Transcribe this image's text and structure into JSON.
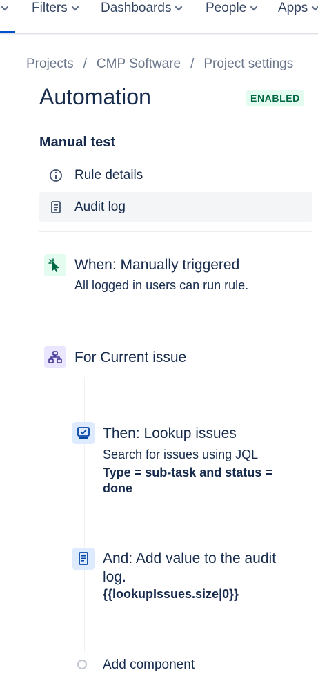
{
  "nav": {
    "items": [
      {
        "label": "Filters"
      },
      {
        "label": "Dashboards"
      },
      {
        "label": "People"
      },
      {
        "label": "Apps"
      }
    ]
  },
  "breadcrumb": {
    "items": [
      "Projects",
      "CMP Software",
      "Project settings"
    ],
    "separator": "/"
  },
  "page": {
    "title": "Automation",
    "status_badge": "ENABLED"
  },
  "rule": {
    "name": "Manual test",
    "menu": [
      {
        "label": "Rule details",
        "icon": "info-icon",
        "selected": false
      },
      {
        "label": "Audit log",
        "icon": "document-icon",
        "selected": true
      }
    ]
  },
  "components": {
    "trigger": {
      "icon": "cursor-icon",
      "title": "When: Manually triggered",
      "description": "All logged in users can run rule."
    },
    "branch": {
      "icon": "hierarchy-icon",
      "title": "For Current issue"
    },
    "action_lookup": {
      "icon": "lookup-icon",
      "title": "Then: Lookup issues",
      "description": "Search for issues using JQL",
      "detail_line1": "Type = sub-task and status =",
      "detail_line2": "done"
    },
    "action_audit": {
      "icon": "audit-log-icon",
      "title_line1": "And: Add value to the audit",
      "title_line2": "log.",
      "detail": "{{lookupIssues.size|0}}"
    },
    "add_component_label": "Add component"
  },
  "colors": {
    "primary_text": "#172b4d",
    "subtle_text": "#6b778c",
    "badge_bg": "#e3fcef",
    "badge_text": "#006644",
    "trigger_icon_bg": "#e3fcef",
    "branch_icon_bg": "#eae6ff",
    "action_icon_bg": "#deebff",
    "nav_active": "#0052cc"
  }
}
